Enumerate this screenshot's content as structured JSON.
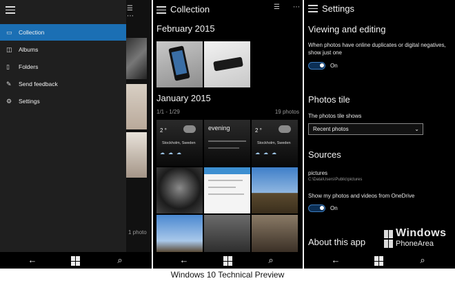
{
  "drawer": {
    "items": [
      {
        "label": "Collection",
        "icon": "collection-icon",
        "glyph": "▭",
        "active": true
      },
      {
        "label": "Albums",
        "icon": "albums-icon",
        "glyph": "◫"
      },
      {
        "label": "Folders",
        "icon": "folders-icon",
        "glyph": "▯"
      },
      {
        "label": "Send feedback",
        "icon": "feedback-icon",
        "glyph": "✎"
      },
      {
        "label": "Settings",
        "icon": "gear-icon",
        "glyph": "⚙"
      }
    ],
    "tail_text": "1 photo",
    "accent_color": "#1b6fb4"
  },
  "collection": {
    "title": "Collection",
    "sections": [
      {
        "title": "February 2015"
      },
      {
        "title": "January 2015",
        "range": "1/1 - 1/29",
        "count": "19 photos"
      }
    ],
    "tiles": [
      {
        "deg": "2 °",
        "location": "Stockholm, Sweden"
      },
      {
        "deg": "evening"
      },
      {
        "deg": "2 °",
        "location": "Stockholm, Sweden"
      }
    ]
  },
  "settings": {
    "title": "Settings",
    "viewing": {
      "heading": "Viewing and editing",
      "description": "When photos have online duplicates or digital negatives, show just one",
      "toggle_label": "On"
    },
    "tile": {
      "heading": "Photos tile",
      "description": "The photos tile shows",
      "selected": "Recent photos"
    },
    "sources": {
      "heading": "Sources",
      "name": "pictures",
      "path": "C:\\Data\\Users\\Public\\pictures",
      "onedrive_label": "Show my photos and videos from OneDrive",
      "toggle_label": "On"
    },
    "about": "About this app"
  },
  "watermark": {
    "line1": "Windows",
    "line2": "PhoneArea"
  },
  "caption": "Windows 10 Technical Preview",
  "nav": {
    "back": "back-icon",
    "start": "windows-icon",
    "search": "search-icon"
  }
}
